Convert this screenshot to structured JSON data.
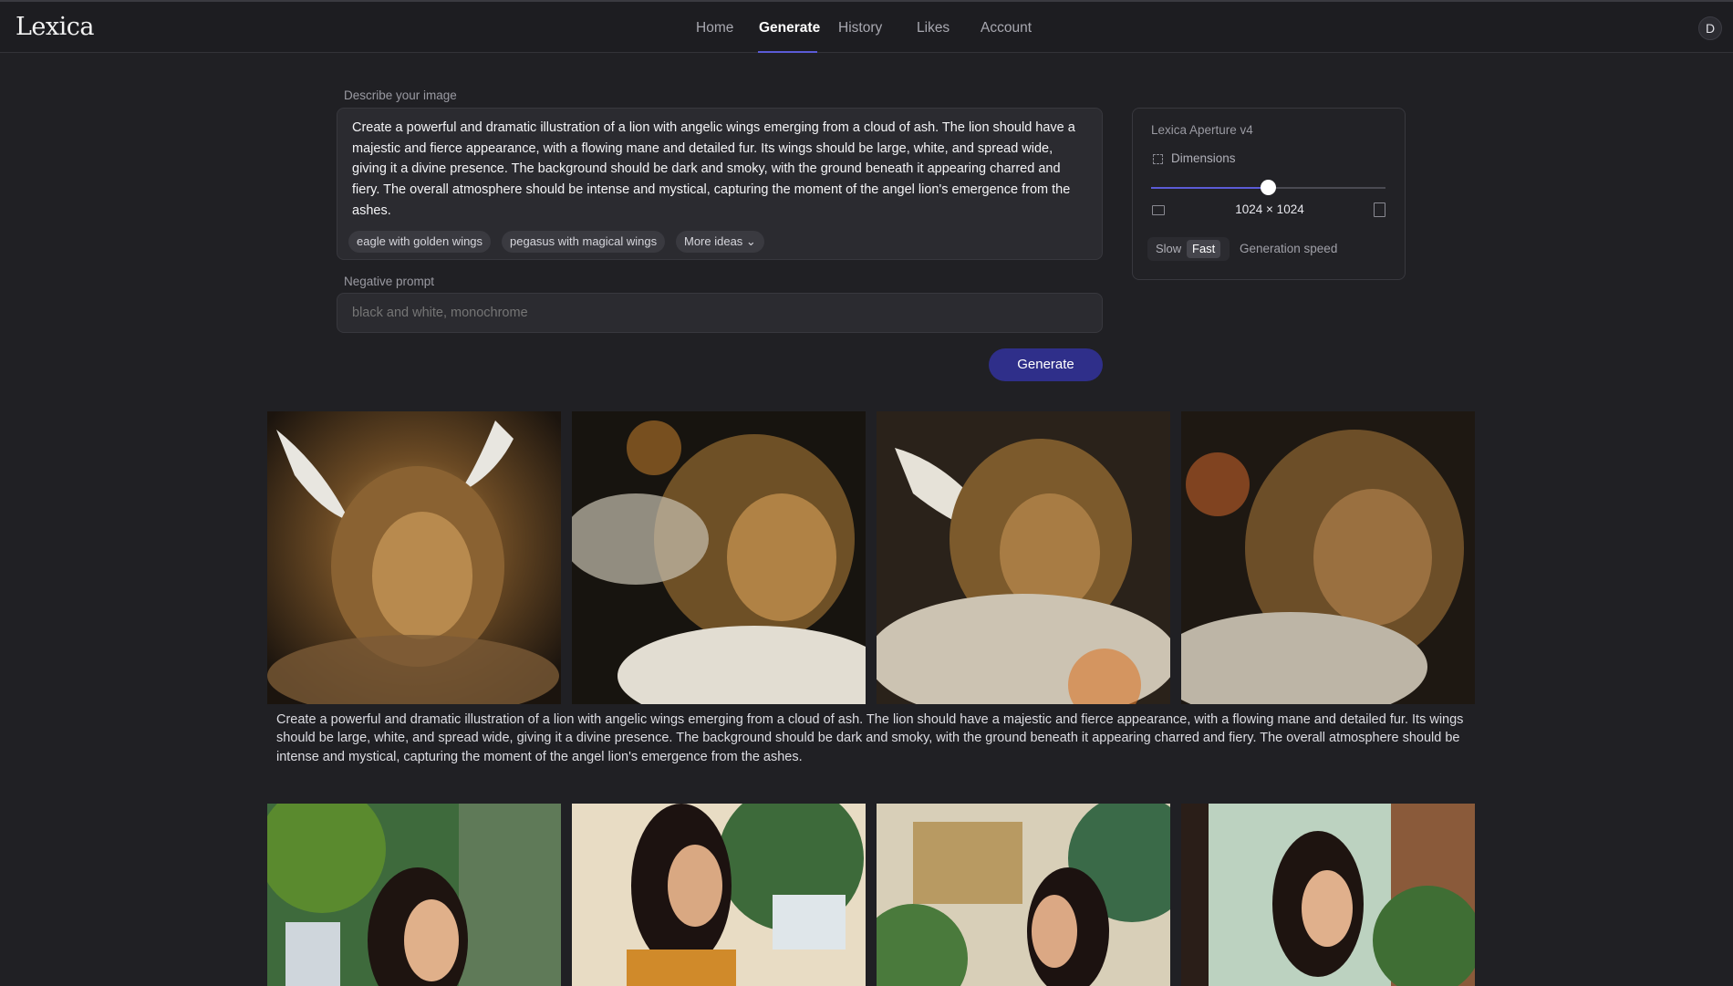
{
  "header": {
    "logo": "Lexica",
    "nav": [
      "Home",
      "Generate",
      "History",
      "Likes",
      "Account"
    ],
    "active_nav": "Generate",
    "avatar": "D"
  },
  "prompt": {
    "label": "Describe your image",
    "text": "Create a powerful and dramatic illustration of a lion with angelic wings emerging from a cloud of ash. The lion should have a majestic and fierce appearance, with a flowing mane and detailed fur. Its wings should be large, white, and spread wide, giving it a divine presence. The background should be dark and smoky, with the ground beneath it appearing charred and fiery. The overall atmosphere should be intense and mystical, capturing the moment of the angel lion's emergence from the ashes.",
    "chips": [
      "eagle with golden wings",
      "pegasus with magical wings",
      "More ideas ⌄"
    ]
  },
  "negative": {
    "label": "Negative prompt",
    "placeholder": "black and white, monochrome"
  },
  "generate_button": "Generate",
  "settings": {
    "model": "Lexica Aperture v4",
    "dimensions_label": "Dimensions",
    "dimensions_value": "1024 × 1024",
    "slider_fraction": 0.5,
    "speed_options": [
      "Slow",
      "Fast"
    ],
    "speed_selected": "Fast",
    "speed_label": "Generation speed"
  },
  "results": [
    {
      "caption": "Create a powerful and dramatic illustration of a lion with angelic wings emerging from a cloud of ash. The lion should have a majestic and fierce appearance, with a flowing mane and detailed fur. Its wings should be large, white, and spread wide, giving it a divine presence. The background should be dark and smoky, with the ground beneath it appearing charred and fiery. The overall atmosphere should be intense and mystical, capturing the moment of the angel lion's emergence from the ashes."
    }
  ]
}
